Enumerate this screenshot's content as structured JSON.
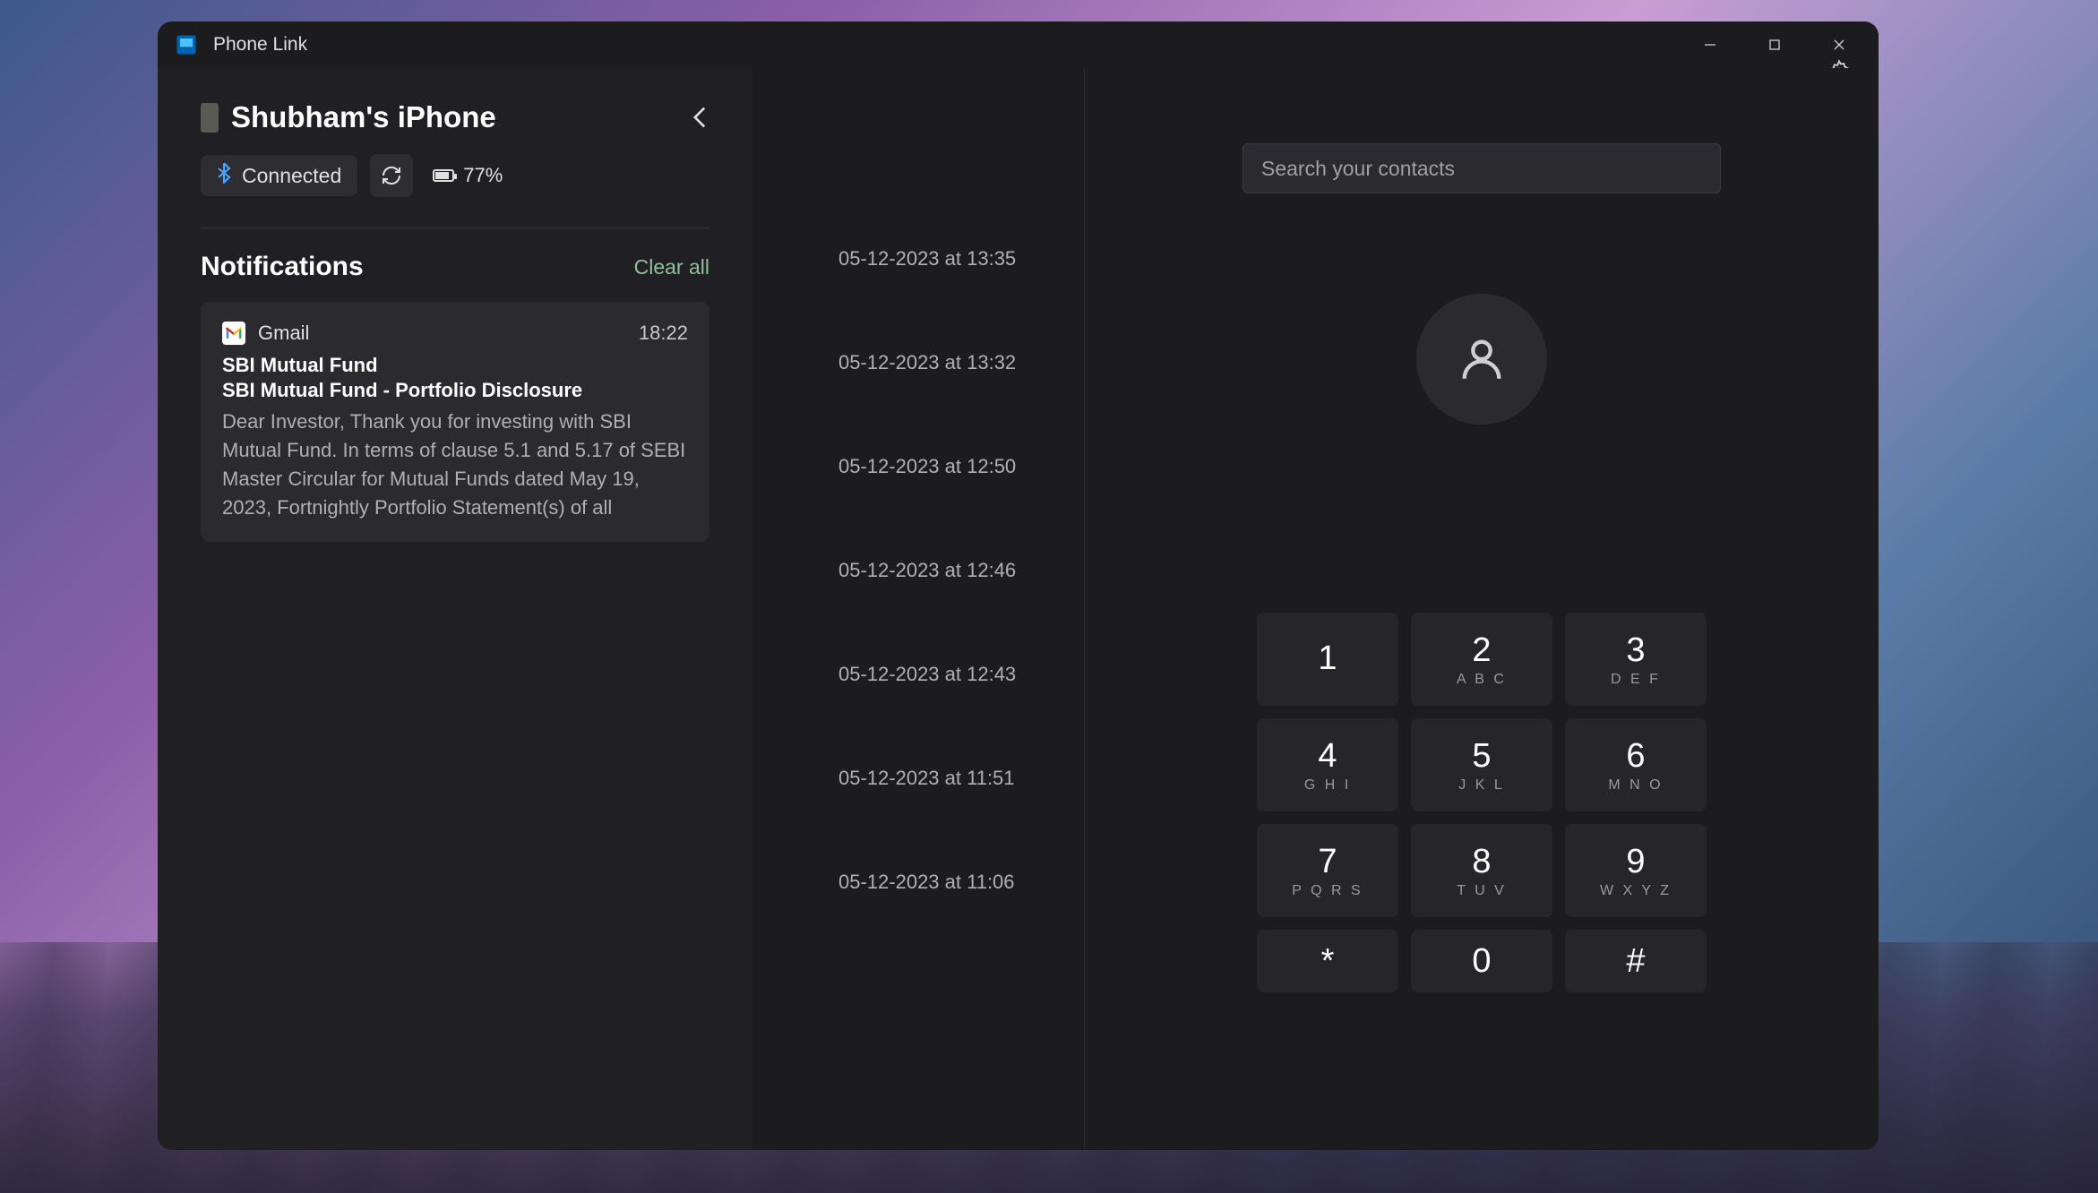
{
  "window": {
    "title": "Phone Link"
  },
  "device": {
    "name": "Shubham's iPhone",
    "connection_label": "Connected",
    "battery_percent": "77%"
  },
  "notifications": {
    "header": "Notifications",
    "clear_all": "Clear all",
    "items": [
      {
        "app": "Gmail",
        "time": "18:22",
        "sender": "SBI Mutual Fund",
        "subject": "SBI Mutual Fund - Portfolio Disclosure",
        "body": "Dear Investor, Thank you for investing with SBI Mutual Fund. In terms of clause 5.1 and 5.17 of SEBI Master Circular for Mutual Funds dated May 19, 2023, Fortnightly Portfolio Statement(s) of all"
      }
    ]
  },
  "calls": [
    {
      "label": "05-12-2023 at 13:35"
    },
    {
      "label": "05-12-2023 at 13:32"
    },
    {
      "label": "05-12-2023 at 12:50"
    },
    {
      "label": "05-12-2023 at 12:46"
    },
    {
      "label": "05-12-2023 at 12:43"
    },
    {
      "label": "05-12-2023 at 11:51"
    },
    {
      "label": "05-12-2023 at 11:06"
    }
  ],
  "dialer": {
    "search_placeholder": "Search your contacts",
    "keys": [
      {
        "digit": "1",
        "letters": ""
      },
      {
        "digit": "2",
        "letters": "A B C"
      },
      {
        "digit": "3",
        "letters": "D E F"
      },
      {
        "digit": "4",
        "letters": "G H I"
      },
      {
        "digit": "5",
        "letters": "J K L"
      },
      {
        "digit": "6",
        "letters": "M N O"
      },
      {
        "digit": "7",
        "letters": "P Q R S"
      },
      {
        "digit": "8",
        "letters": "T U V"
      },
      {
        "digit": "9",
        "letters": "W X Y Z"
      },
      {
        "digit": "*",
        "letters": ""
      },
      {
        "digit": "0",
        "letters": ""
      },
      {
        "digit": "#",
        "letters": ""
      }
    ]
  }
}
